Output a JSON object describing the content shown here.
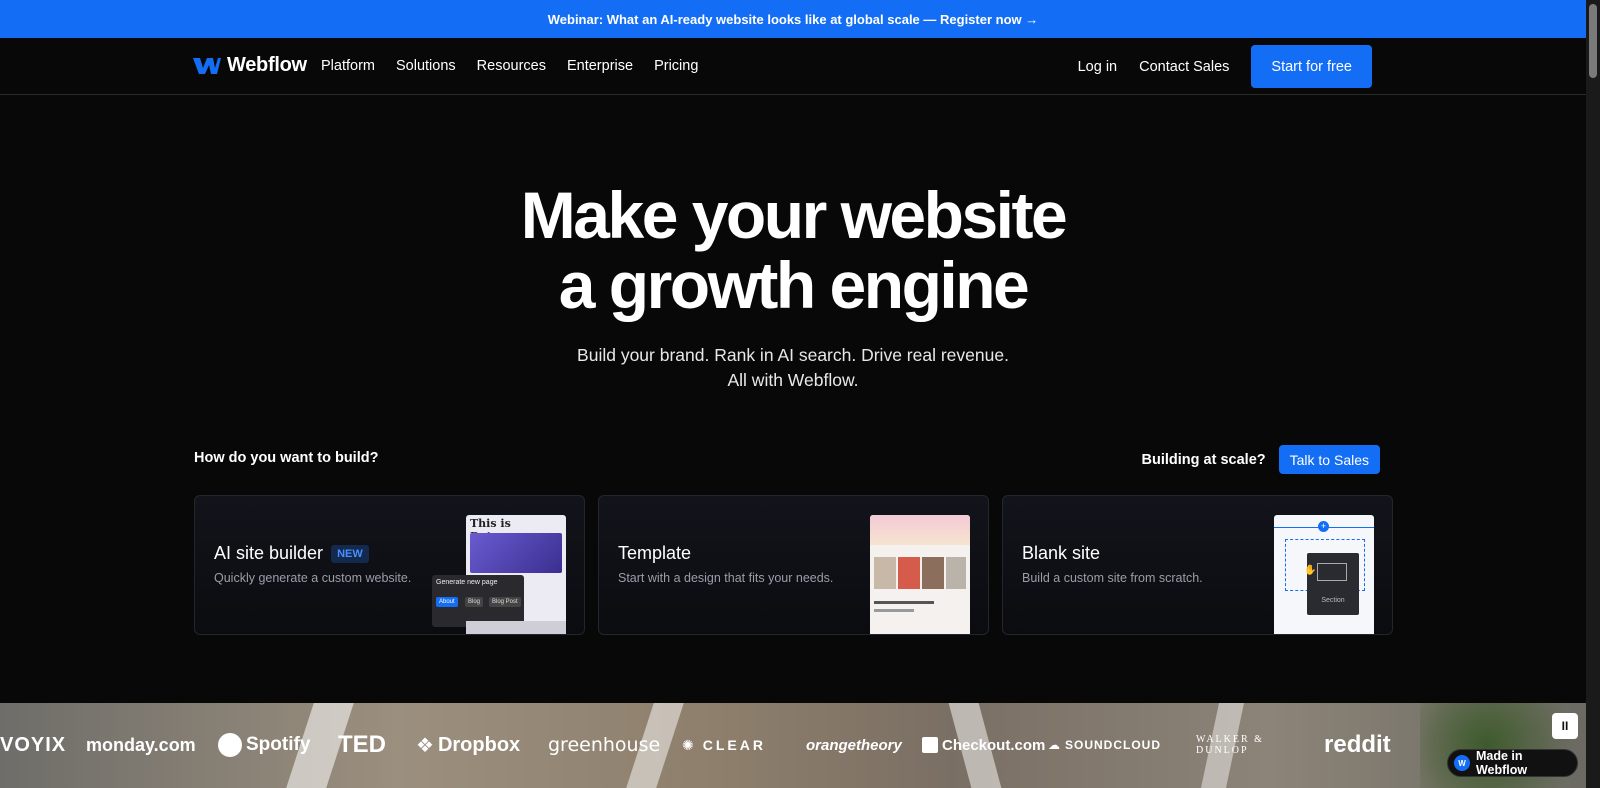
{
  "banner": {
    "text": "Webinar: What an AI-ready website looks like at global scale — Register now →"
  },
  "nav": {
    "logo_text": "Webflow",
    "links": [
      "Platform",
      "Solutions",
      "Resources",
      "Enterprise",
      "Pricing"
    ],
    "login": "Log in",
    "contact": "Contact Sales",
    "cta": "Start for free"
  },
  "hero": {
    "title_line1": "Make your website",
    "title_line2": "a growth engine",
    "sub_line1": "Build your brand. Rank in AI search. Drive real revenue.",
    "sub_line2": "All with Webflow."
  },
  "build": {
    "question": "How do you want to build?",
    "scale_question": "Building at scale?",
    "scale_cta": "Talk to Sales"
  },
  "cards": [
    {
      "title": "AI site builder",
      "badge": "NEW",
      "desc": "Quickly generate a custom website.",
      "thumb": {
        "headline": "This is Dataway",
        "prompt": "Generate new page",
        "chips": [
          "About",
          "Blog",
          "Blog Post"
        ]
      }
    },
    {
      "title": "Template",
      "desc": "Start with a design that fits your needs."
    },
    {
      "title": "Blank site",
      "desc": "Build a custom site from scratch.",
      "thumb": {
        "label": "Section"
      }
    }
  ],
  "logos": [
    "VOYIX",
    "monday.com",
    "Spotify",
    "TED",
    "Dropbox",
    "greenhouse",
    "CLEAR",
    "orangetheory",
    "Checkout.com",
    "SOUNDCLOUD",
    "WALKER & DUNLOP",
    "reddit"
  ],
  "controls": {
    "pause": "II",
    "made_in": "Made in Webflow"
  },
  "colors": {
    "accent": "#146ef5",
    "background": "#080808"
  }
}
